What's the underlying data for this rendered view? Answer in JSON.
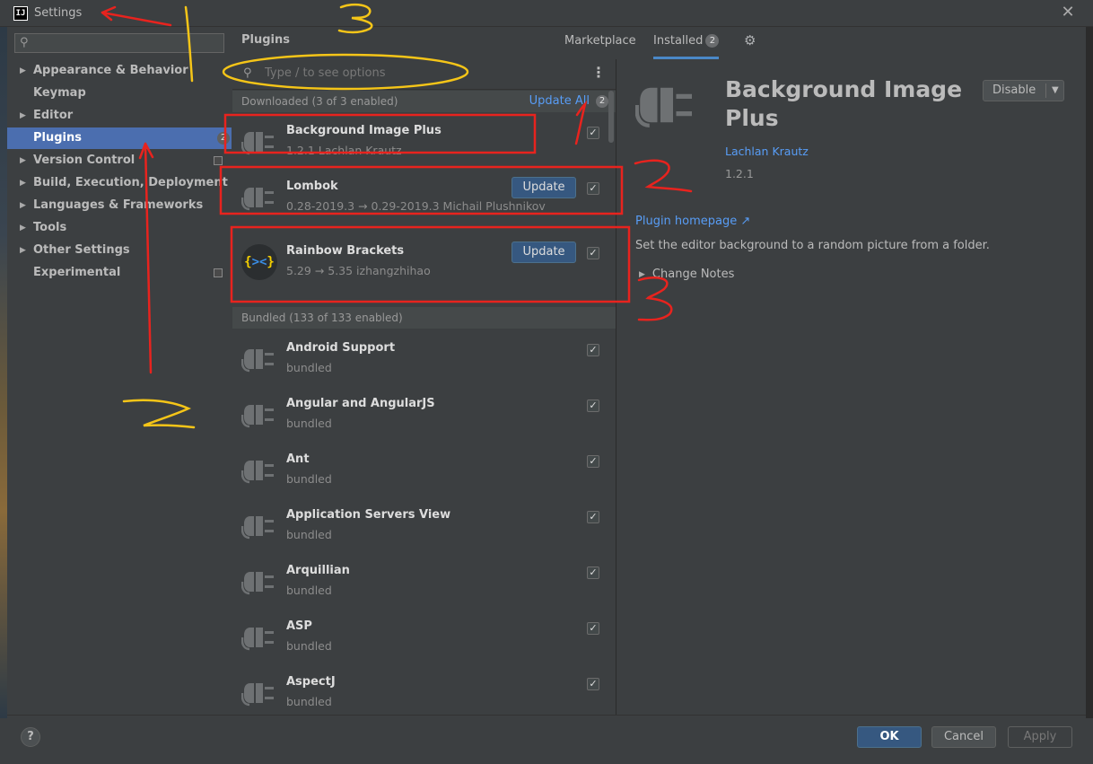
{
  "window": {
    "title": "Settings",
    "logo_text": "IJ",
    "close_glyph": "✕"
  },
  "sidebar": {
    "search_placeholder": "",
    "items": [
      {
        "label": "Appearance & Behavior",
        "expandable": true
      },
      {
        "label": "Keymap",
        "expandable": false
      },
      {
        "label": "Editor",
        "expandable": true
      },
      {
        "label": "Plugins",
        "expandable": false,
        "selected": true,
        "badge": "2"
      },
      {
        "label": "Version Control",
        "expandable": true
      },
      {
        "label": "Build, Execution, Deployment",
        "expandable": true
      },
      {
        "label": "Languages & Frameworks",
        "expandable": true
      },
      {
        "label": "Tools",
        "expandable": true
      },
      {
        "label": "Other Settings",
        "expandable": true
      },
      {
        "label": "Experimental",
        "expandable": false
      }
    ]
  },
  "plugins_header": {
    "title": "Plugins",
    "tabs": [
      {
        "label": "Marketplace"
      },
      {
        "label": "Installed",
        "badge": "2",
        "active": true
      }
    ]
  },
  "list": {
    "search_placeholder": "Type / to see options",
    "downloaded_header": "Downloaded (3 of 3 enabled)",
    "update_all": "Update All",
    "update_all_badge": "2",
    "bundled_header": "Bundled (133 of 133 enabled)",
    "downloaded": [
      {
        "name": "Background Image Plus",
        "sub": "1.2.1  Lachlan Krautz",
        "update": false,
        "checked": true
      },
      {
        "name": "Lombok",
        "sub": "0.28-2019.3 → 0.29-2019.3  Michail   Plushnikov",
        "update": true,
        "update_label": "Update",
        "checked": true
      },
      {
        "name": "Rainbow Brackets",
        "sub": "5.29 → 5.35  izhangzhihao",
        "update": true,
        "update_label": "Update",
        "checked": true
      }
    ],
    "bundled": [
      {
        "name": "Android Support",
        "sub": "bundled",
        "checked": true
      },
      {
        "name": "Angular and AngularJS",
        "sub": "bundled",
        "checked": true
      },
      {
        "name": "Ant",
        "sub": "bundled",
        "checked": true
      },
      {
        "name": "Application Servers View",
        "sub": "bundled",
        "checked": true
      },
      {
        "name": "Arquillian",
        "sub": "bundled",
        "checked": true
      },
      {
        "name": "ASP",
        "sub": "bundled",
        "checked": true
      },
      {
        "name": "AspectJ",
        "sub": "bundled",
        "checked": true
      }
    ],
    "rainbow_icon_text": "{><}"
  },
  "detail": {
    "title": "Background Image Plus",
    "disable_label": "Disable",
    "author": "Lachlan Krautz",
    "version": "1.2.1",
    "homepage": "Plugin homepage ↗",
    "description": "Set the editor background to a random picture from a folder.",
    "change_notes": "Change Notes"
  },
  "buttons": {
    "help": "?",
    "ok": "OK",
    "cancel": "Cancel",
    "apply": "Apply"
  },
  "annotations": {
    "yellow_marks": [
      "1",
      "2",
      "3"
    ],
    "red_marks": [
      "1",
      "2",
      "3"
    ]
  },
  "colors": {
    "accent_blue": "#4b6eaf",
    "link_blue": "#589df6",
    "button_blue": "#365880",
    "annotation_red": "#e8231e",
    "annotation_yellow": "#f5c518"
  }
}
